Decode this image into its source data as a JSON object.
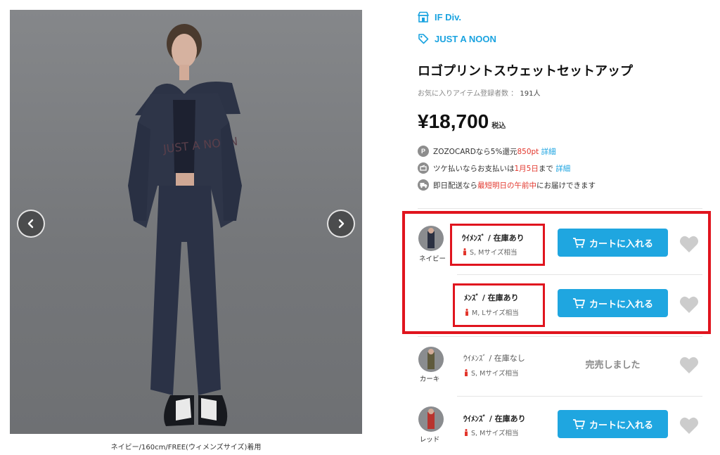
{
  "gallery": {
    "caption": "ネイビー/160cm/FREE(ウィメンズサイズ)着用",
    "prev_icon": "chevron-left-icon",
    "next_icon": "chevron-right-icon"
  },
  "product": {
    "shop": "IF Div.",
    "brand": "JUST A NOON",
    "title": "ロゴプリントスウェットセットアップ",
    "favorites_label": "お気に入りアイテム登録者数 ：",
    "favorites_count": "191人",
    "price": "¥18,700",
    "tax_label": "税込"
  },
  "info": {
    "zozocard": {
      "icon": "P",
      "text_pre": "ZOZOCARDなら5%還元",
      "points": "850pt",
      "link": "詳細"
    },
    "tsuke": {
      "text_pre": "ツケ払いならお支払いは",
      "date": "1月5日",
      "text_post": "まで",
      "link": "詳細"
    },
    "delivery": {
      "text_pre": "即日配送なら",
      "highlight": "最短明日の午前中",
      "text_post": "にお届けできます"
    }
  },
  "variants": [
    {
      "color": "ネイビー",
      "stock": "ｳｲﾒﾝｽﾞ / 在庫あり",
      "size": "S, Mサイズ相当",
      "action": "カートに入れる",
      "available": true
    },
    {
      "color": "",
      "stock": "ﾒﾝｽﾞ / 在庫あり",
      "size": "M, Lサイズ相当",
      "action": "カートに入れる",
      "available": true
    },
    {
      "color": "カーキ",
      "stock": "ｳｲﾒﾝｽﾞ / 在庫なし",
      "size": "S, Mサイズ相当",
      "action": "完売しました",
      "available": false
    },
    {
      "color": "レッド",
      "stock": "ｳｲﾒﾝｽﾞ / 在庫あり",
      "size": "S, Mサイズ相当",
      "action": "カートに入れる",
      "available": true
    }
  ],
  "colors": {
    "accent": "#1fa6e0",
    "brand_blue": "#1aa3e0",
    "highlight_red": "#e0141e",
    "price_red": "#e2352b",
    "swatch_navy": "#2b3142",
    "swatch_khaki": "#5f5a3c",
    "swatch_red": "#b8342e"
  }
}
